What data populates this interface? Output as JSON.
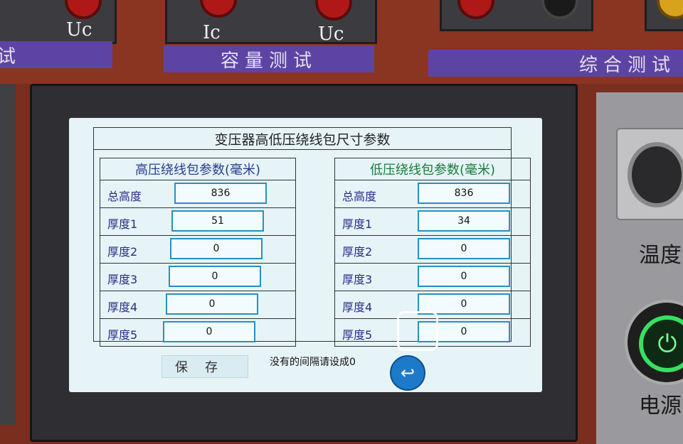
{
  "device": {
    "jacks_left": {
      "label_uc": "Uc"
    },
    "jacks_middle": {
      "label_ic": "Ic",
      "label_uc": "Uc"
    },
    "labels": {
      "left_partial": "试",
      "middle": "容量测试",
      "right": "综合测试"
    },
    "side_text": {
      "temperature": "温度",
      "power": "电源"
    },
    "icons": {
      "power": "power-icon",
      "back": "return-arrow-icon",
      "connector": "aviation-connector-icon"
    }
  },
  "screen": {
    "title": "变压器高低压绕线包尺寸参数",
    "high_voltage": {
      "heading": "高压绕线包参数(毫米)",
      "rows": [
        {
          "label": "总高度",
          "value": "836"
        },
        {
          "label": "厚度1",
          "value": "51"
        },
        {
          "label": "厚度2",
          "value": "0"
        },
        {
          "label": "厚度3",
          "value": "0"
        },
        {
          "label": "厚度4",
          "value": "0"
        },
        {
          "label": "厚度5",
          "value": "0"
        }
      ]
    },
    "low_voltage": {
      "heading": "低压绕线包参数(毫米)",
      "rows": [
        {
          "label": "总高度",
          "value": "836"
        },
        {
          "label": "厚度1",
          "value": "34"
        },
        {
          "label": "厚度2",
          "value": "0"
        },
        {
          "label": "厚度3",
          "value": "0"
        },
        {
          "label": "厚度4",
          "value": "0"
        },
        {
          "label": "厚度5",
          "value": "0"
        }
      ]
    },
    "save_label": "保存",
    "hint": "没有的间隔请设成0"
  },
  "colors": {
    "screen_bg": "#e6f4f7",
    "field_border": "#2a8fc0",
    "high_heading": "#2a3d8f",
    "low_heading": "#1a7a3a",
    "label_purple": "#5d44a4",
    "power_green": "#38e060"
  }
}
